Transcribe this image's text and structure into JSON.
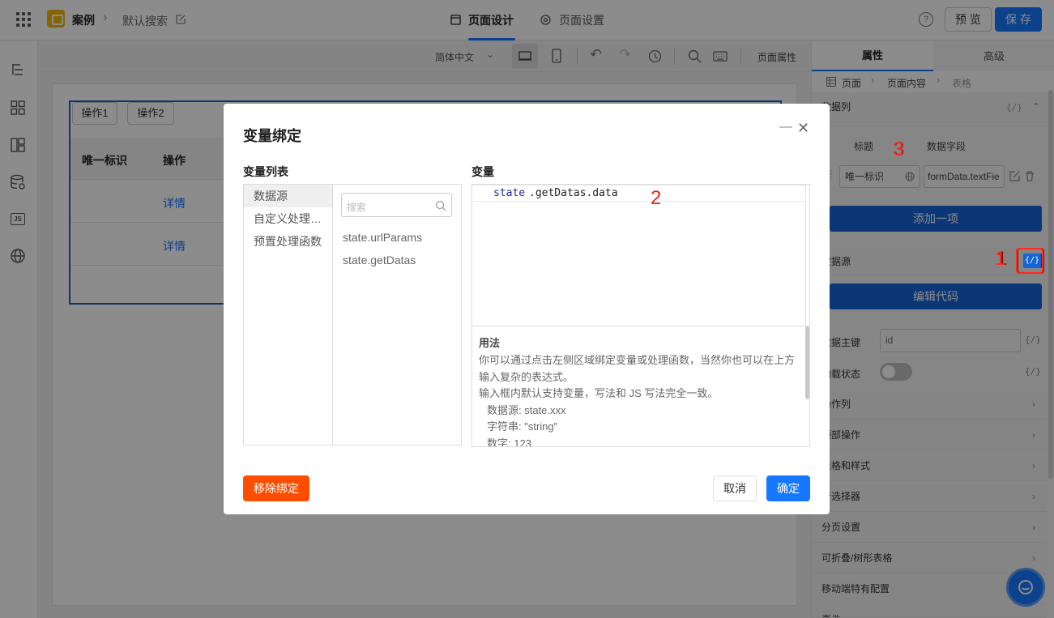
{
  "topbar": {
    "app_name": "案例",
    "page_name": "默认搜索",
    "tabs": [
      "页面设计",
      "页面设置"
    ],
    "help_icon": "question-circle-icon",
    "preview_label": "预 览",
    "save_label": "保 存"
  },
  "toolbar": {
    "language": "简体中文",
    "page_props_label": "页面属性"
  },
  "canvas": {
    "buttons": [
      "操作1",
      "操作2"
    ],
    "table_headers": [
      "唯一标识",
      "操作"
    ],
    "rows": [
      {
        "action": "详情"
      },
      {
        "action": "详情"
      }
    ]
  },
  "rightpanel": {
    "tabs": [
      "属性",
      "高级"
    ],
    "breadcrumb": [
      "页面",
      "页面内容",
      "表格"
    ],
    "datacol_title": "数据列",
    "col_title_header": "标题",
    "col_field_header": "数据字段",
    "col_title_value": "唯一标识",
    "col_field_value": "formData.textFie",
    "add_item_label": "添加一项",
    "datasource_label": "数据源",
    "edit_code_label": "编辑代码",
    "primary_key_label": "数据主键",
    "primary_key_value": "id",
    "loading_label": "加载状态",
    "bind_icon_text": "{/}",
    "sections": [
      "操作列",
      "顶部操作",
      "表格和样式",
      "行选择器",
      "分页设置",
      "可折叠/树形表格",
      "移动端特有配置",
      "事件"
    ]
  },
  "modal": {
    "title": "变量绑定",
    "var_list_label": "变量列表",
    "categories": [
      "数据源",
      "自定义处理…",
      "预置处理函数"
    ],
    "search_placeholder": "搜索",
    "vars": [
      "state.urlParams",
      "state.getDatas"
    ],
    "variable_label": "变量",
    "code_obj": "state",
    "code_rest": ".getDatas.data",
    "usage_title": "用法",
    "usage_lines": [
      "你可以通过点击左侧区域绑定变量或处理函数，当然你也可以在上方输入复杂的表达式。",
      "输入框内默认支持变量，写法和 JS 写法完全一致。",
      "数据源: state.xxx",
      "字符串: \"string\"",
      "数字: 123"
    ],
    "remove_label": "移除绑定",
    "cancel_label": "取消",
    "confirm_label": "确定"
  },
  "annotations": [
    "1",
    "2",
    "3"
  ],
  "colors": {
    "primary": "#1677ff",
    "danger": "#ff4d00",
    "annotation": "#e21111"
  }
}
